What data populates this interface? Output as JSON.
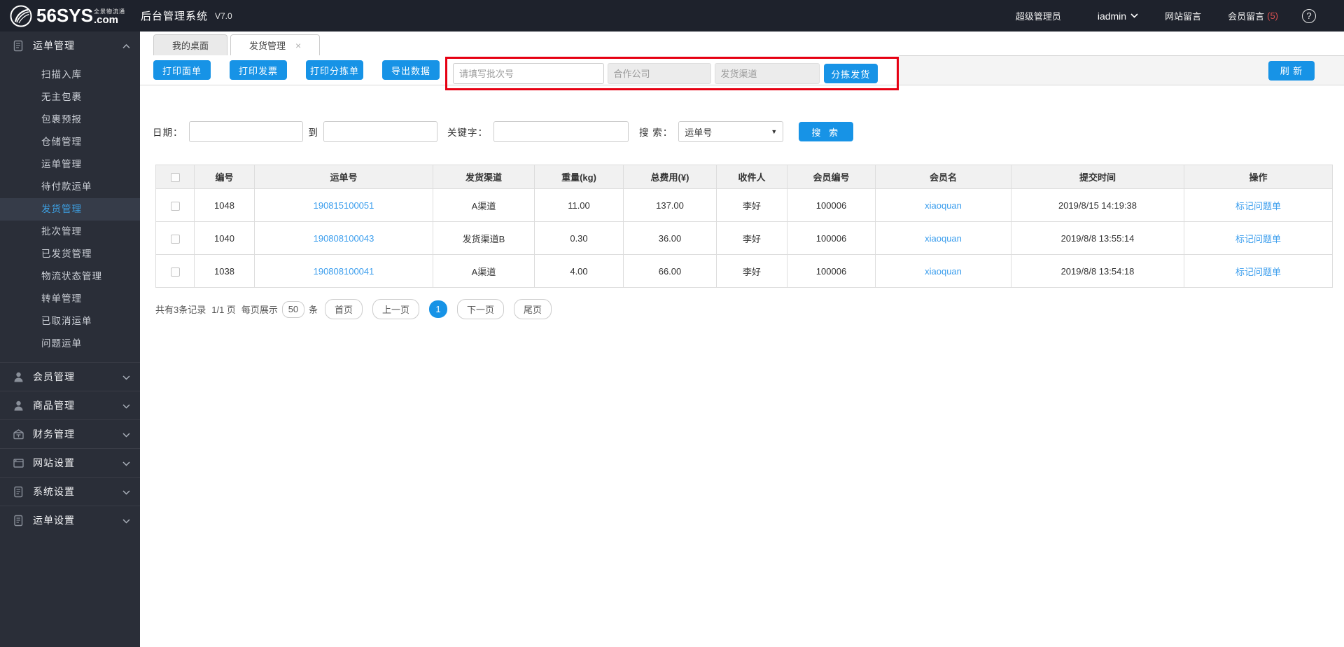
{
  "header": {
    "logo_main": "56SYS",
    "logo_tagline": "全景物流通",
    "logo_suffix": ".com",
    "app_title": "后台管理系统",
    "version": "V7.0",
    "role": "超级管理员",
    "username": "iadmin",
    "nav": [
      {
        "label": "网站留言",
        "badge": ""
      },
      {
        "label": "会员留言",
        "badge": "(5)"
      }
    ],
    "help_label": "?",
    "badge_color": "#e05252"
  },
  "sidebar": {
    "sections": [
      {
        "label": "运单管理",
        "icon": "waybill-doc-icon",
        "expanded": true,
        "children": [
          "扫描入库",
          "无主包裹",
          "包裹预报",
          "仓储管理",
          "运单管理",
          "待付款运单",
          "发货管理",
          "批次管理",
          "已发货管理",
          "物流状态管理",
          "转单管理",
          "已取消运单",
          "问题运单"
        ],
        "active_child": "发货管理"
      },
      {
        "label": "会员管理",
        "icon": "person-icon",
        "expanded": false,
        "children": []
      },
      {
        "label": "商品管理",
        "icon": "person-icon",
        "expanded": false,
        "children": []
      },
      {
        "label": "财务管理",
        "icon": "finance-icon",
        "expanded": false,
        "children": []
      },
      {
        "label": "网站设置",
        "icon": "browser-icon",
        "expanded": false,
        "children": []
      },
      {
        "label": "系统设置",
        "icon": "doc-icon",
        "expanded": false,
        "children": []
      },
      {
        "label": "运单设置",
        "icon": "doc-icon",
        "expanded": false,
        "children": []
      }
    ]
  },
  "tabs": [
    {
      "label": "我的桌面",
      "active": false,
      "closable": false
    },
    {
      "label": "发货管理",
      "active": true,
      "closable": true,
      "close_glyph": "×"
    }
  ],
  "toolbar": {
    "buttons": [
      "打印面单",
      "打印发票",
      "打印分拣单",
      "导出数据"
    ],
    "batch_placeholder": "请填写批次号",
    "company_placeholder": "合作公司",
    "channel_placeholder": "发货渠道",
    "sort_ship_label": "分拣发货",
    "refresh_label": "刷 新"
  },
  "filters": {
    "date_label": "日期：",
    "to_label": "到",
    "keyword_label": "关键字：",
    "search_label": "搜 索：",
    "search_type_value": "运单号",
    "select_arrow": "▼",
    "search_button": "搜 索"
  },
  "table": {
    "columns": [
      "编号",
      "运单号",
      "发货渠道",
      "重量(kg)",
      "总费用(¥)",
      "收件人",
      "会员编号",
      "会员名",
      "提交时间",
      "操作"
    ],
    "rows": [
      {
        "id": "1048",
        "waybill": "190815100051",
        "channel": "A渠道",
        "weight": "11.00",
        "fee": "137.00",
        "recipient": "李好",
        "member_no": "100006",
        "member": "xiaoquan",
        "time": "2019/8/15 14:19:38",
        "action": "标记问题单"
      },
      {
        "id": "1040",
        "waybill": "190808100043",
        "channel": "发货渠道B",
        "weight": "0.30",
        "fee": "36.00",
        "recipient": "李好",
        "member_no": "100006",
        "member": "xiaoquan",
        "time": "2019/8/8 13:55:14",
        "action": "标记问题单"
      },
      {
        "id": "1038",
        "waybill": "190808100041",
        "channel": "A渠道",
        "weight": "4.00",
        "fee": "66.00",
        "recipient": "李好",
        "member_no": "100006",
        "member": "xiaoquan",
        "time": "2019/8/8 13:54:18",
        "action": "标记问题单"
      }
    ]
  },
  "pagination": {
    "summary": "共有3条记录",
    "page_info": "1/1 页",
    "per_page_label": "每页展示",
    "per_page_value": "50",
    "unit_label": "条",
    "first": "首页",
    "prev": "上一页",
    "current": "1",
    "next": "下一页",
    "last": "尾页"
  },
  "colors": {
    "accent_blue": "#1793e6",
    "annotation_red": "#e60012",
    "link_blue": "#3a9ded",
    "topbar_bg": "#1e222c",
    "sidebar_bg": "#2a2e38",
    "active_item_text": "#3da0e3",
    "badge_red": "#e05252"
  }
}
